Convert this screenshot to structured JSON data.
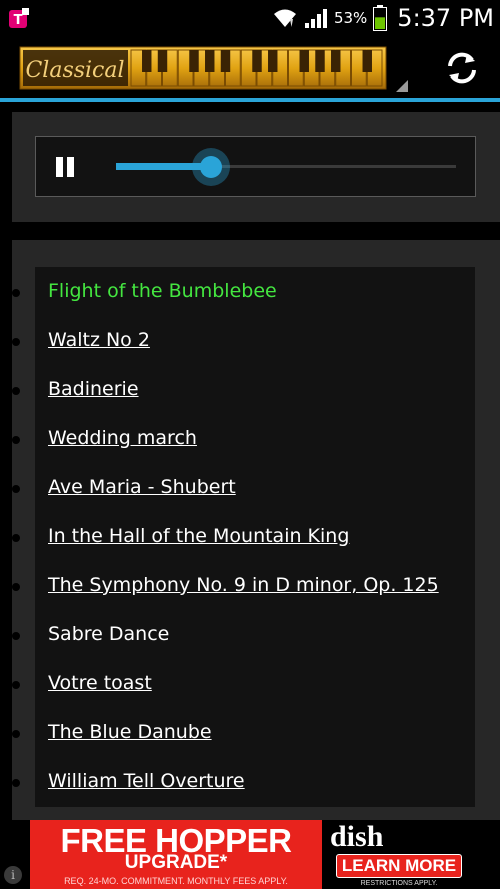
{
  "status_bar": {
    "app_icon": "t-mobile-icon",
    "wifi_icon": "wifi-icon",
    "signal_icon": "signal-icon",
    "battery_percent": "53%",
    "battery_level": 0.53,
    "time": "5:37 PM"
  },
  "header": {
    "genre_label": "Classical",
    "refresh_icon": "refresh-icon",
    "accent_color": "#2aa4d8"
  },
  "player": {
    "state": "playing",
    "control_icon": "pause-icon",
    "progress": 0.28
  },
  "playlist": {
    "current_color": "#44e640",
    "tracks": [
      {
        "title": "Flight of the Bumblebee",
        "style": "current"
      },
      {
        "title": "Waltz No 2",
        "style": "link"
      },
      {
        "title": "Badinerie",
        "style": "link"
      },
      {
        "title": "Wedding march",
        "style": "link"
      },
      {
        "title": "Ave Maria - Shubert",
        "style": "link"
      },
      {
        "title": "In the Hall of the Mountain King",
        "style": "link"
      },
      {
        "title": "The Symphony No. 9 in D minor, Op. 125",
        "style": "link"
      },
      {
        "title": "Sabre Dance",
        "style": "plain"
      },
      {
        "title": "Votre toast",
        "style": "link"
      },
      {
        "title": "The Blue Danube",
        "style": "link"
      },
      {
        "title": "William Tell Overture",
        "style": "link"
      }
    ]
  },
  "ad": {
    "headline": "FREE HOPPER",
    "subline": "UPGRADE*",
    "fine_print": "REQ. 24-MO. COMMITMENT. MONTHLY FEES APPLY.",
    "brand": "dish",
    "cta": "LEARN MORE",
    "cta_fine": "RESTRICTIONS APPLY.",
    "info_icon": "info-icon"
  }
}
